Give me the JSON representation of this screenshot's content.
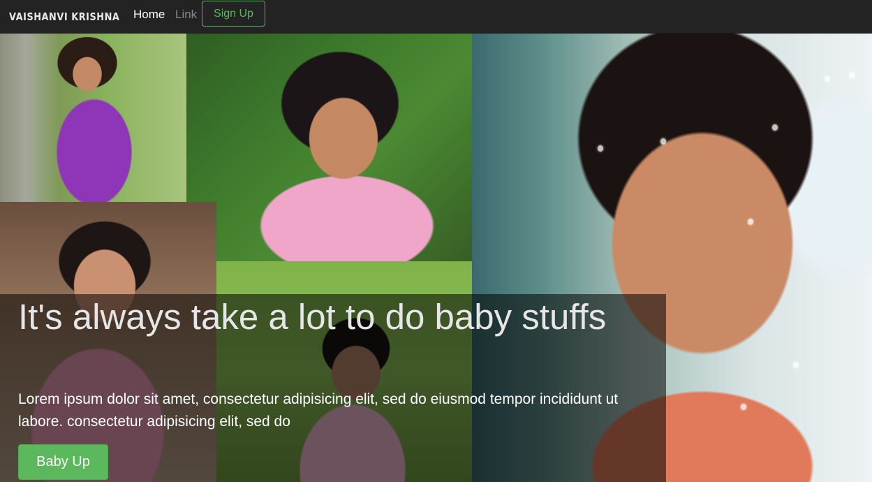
{
  "navbar": {
    "brand": "VAISHANVI KRISHNA",
    "home_label": "Home",
    "link_label": "Link",
    "signup_label": "Sign Up"
  },
  "hero": {
    "title": "It's always take a lot to do baby stuffs",
    "text": "Lorem ipsum dolor sit amet, consectetur adipisicing elit, sed do eiusmod tempor incididunt ut labore. consectetur adipisicing elit, sed do",
    "button_label": "Baby Up"
  },
  "colors": {
    "navbar_bg": "#232323",
    "accent_green": "#5cb85c",
    "overlay": "rgba(0,0,0,0.55)"
  }
}
